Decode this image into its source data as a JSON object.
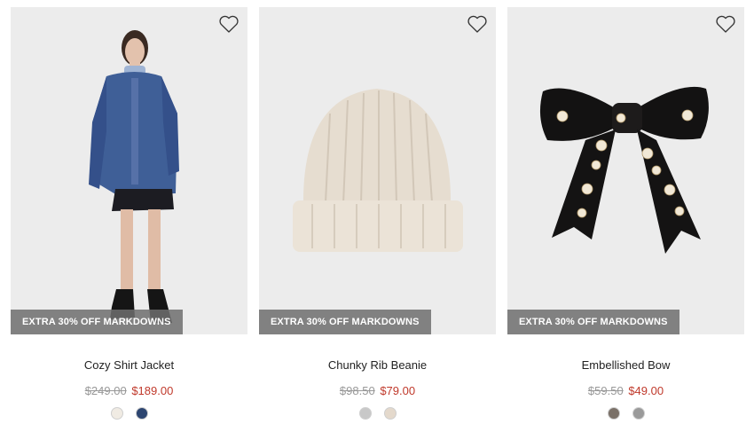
{
  "colors": {
    "sale_price": "#c0392b",
    "original_price": "#999999",
    "badge_bg": "#6e6e6e",
    "image_bg": "#ececec"
  },
  "products": [
    {
      "name": "Cozy Shirt Jacket",
      "badge": "EXTRA 30% OFF MARKDOWNS",
      "original_price": "$249.00",
      "sale_price": "$189.00",
      "swatches": [
        "#f0ebe3",
        "#2d4570"
      ],
      "wishlist_icon": "heart-outline-icon"
    },
    {
      "name": "Chunky Rib Beanie",
      "badge": "EXTRA 30% OFF MARKDOWNS",
      "original_price": "$98.50",
      "sale_price": "$79.00",
      "swatches": [
        "#c8c8c8",
        "#e4d9cc"
      ],
      "wishlist_icon": "heart-outline-icon"
    },
    {
      "name": "Embellished Bow",
      "badge": "EXTRA 30% OFF MARKDOWNS",
      "original_price": "$59.50",
      "sale_price": "$49.00",
      "swatches": [
        "#7a7068",
        "#9a9a9a"
      ],
      "wishlist_icon": "heart-outline-icon"
    }
  ]
}
